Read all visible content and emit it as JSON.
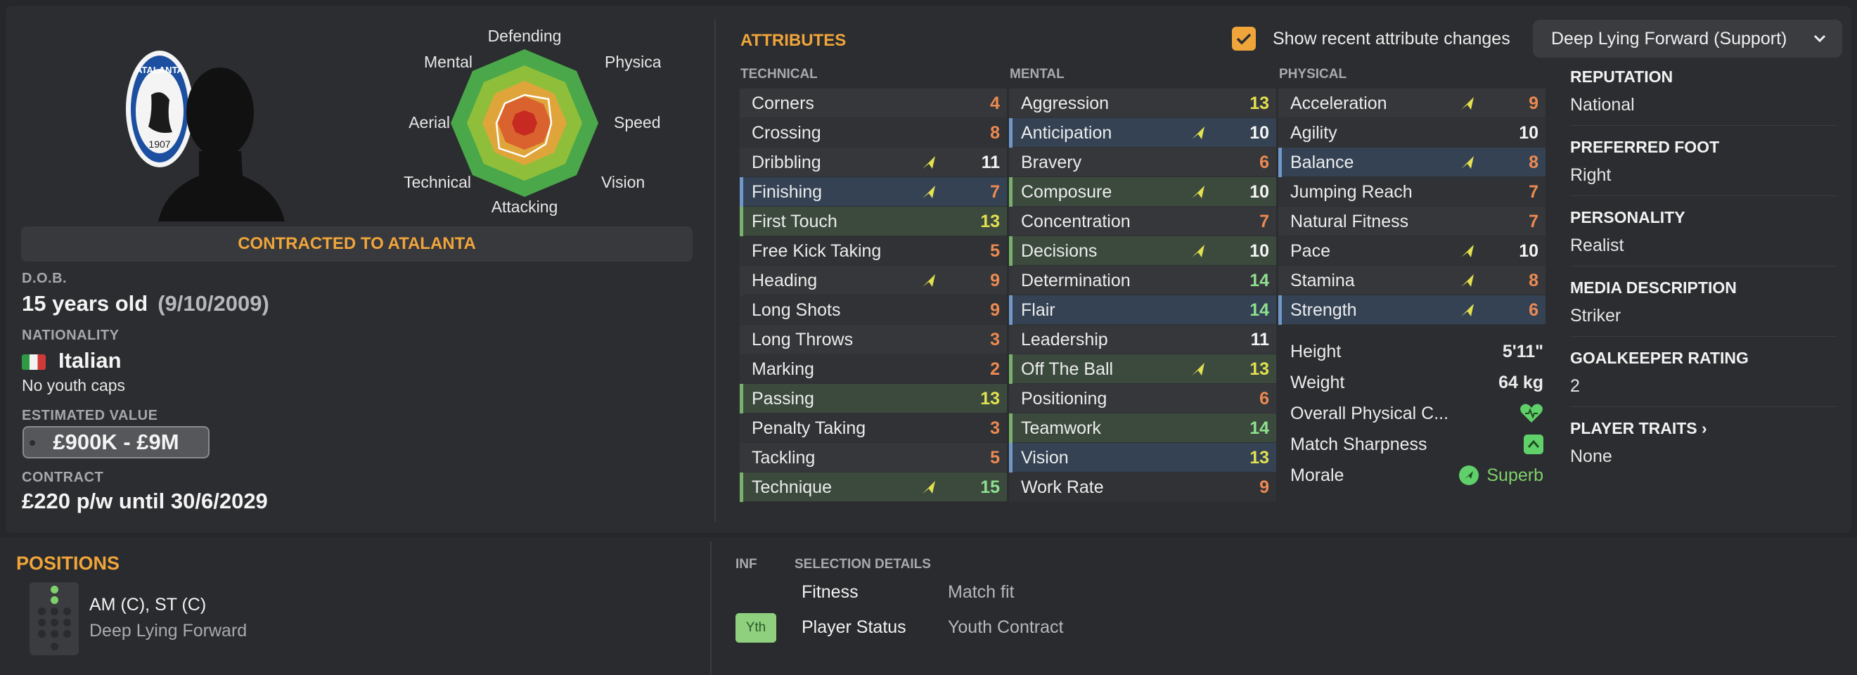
{
  "profile": {
    "club_badge_text": "ATALANTA",
    "club_badge_year": "1907",
    "contracted_banner": "CONTRACTED TO ATALANTA",
    "dob_label": "D.O.B.",
    "age": "15 years old",
    "dob": "(9/10/2009)",
    "nationality_label": "NATIONALITY",
    "nationality": "Italian",
    "youth_caps": "No youth caps",
    "value_label": "ESTIMATED VALUE",
    "value": "£900K - £9M",
    "contract_label": "CONTRACT",
    "contract": "£220 p/w until 30/6/2029"
  },
  "radar": {
    "labels": [
      "Defending",
      "Physical",
      "Speed",
      "Vision",
      "Attacking",
      "Technical",
      "Aerial",
      "Mental"
    ]
  },
  "attributes": {
    "title": "ATTRIBUTES",
    "technical_header": "TECHNICAL",
    "mental_header": "MENTAL",
    "physical_header": "PHYSICAL",
    "technical": [
      {
        "name": "Corners",
        "value": "4",
        "color": "#ec8a52",
        "arrow": false,
        "hl": ""
      },
      {
        "name": "Crossing",
        "value": "8",
        "color": "#ec8a52",
        "arrow": false,
        "hl": ""
      },
      {
        "name": "Dribbling",
        "value": "11",
        "color": "#f4f4f4",
        "arrow": true,
        "hl": ""
      },
      {
        "name": "Finishing",
        "value": "7",
        "color": "#ec8a52",
        "arrow": true,
        "hl": "blue"
      },
      {
        "name": "First Touch",
        "value": "13",
        "color": "#e3e14f",
        "arrow": false,
        "hl": "green"
      },
      {
        "name": "Free Kick Taking",
        "value": "5",
        "color": "#ec8a52",
        "arrow": false,
        "hl": ""
      },
      {
        "name": "Heading",
        "value": "9",
        "color": "#ec8a52",
        "arrow": true,
        "hl": ""
      },
      {
        "name": "Long Shots",
        "value": "9",
        "color": "#ec8a52",
        "arrow": false,
        "hl": ""
      },
      {
        "name": "Long Throws",
        "value": "3",
        "color": "#ec8a52",
        "arrow": false,
        "hl": ""
      },
      {
        "name": "Marking",
        "value": "2",
        "color": "#ec8a52",
        "arrow": false,
        "hl": ""
      },
      {
        "name": "Passing",
        "value": "13",
        "color": "#e3e14f",
        "arrow": false,
        "hl": "green"
      },
      {
        "name": "Penalty Taking",
        "value": "3",
        "color": "#ec8a52",
        "arrow": false,
        "hl": ""
      },
      {
        "name": "Tackling",
        "value": "5",
        "color": "#ec8a52",
        "arrow": false,
        "hl": ""
      },
      {
        "name": "Technique",
        "value": "15",
        "color": "#8fe08f",
        "arrow": true,
        "hl": "green"
      }
    ],
    "mental": [
      {
        "name": "Aggression",
        "value": "13",
        "color": "#e3e14f",
        "arrow": false,
        "hl": ""
      },
      {
        "name": "Anticipation",
        "value": "10",
        "color": "#f4f4f4",
        "arrow": true,
        "hl": "blue"
      },
      {
        "name": "Bravery",
        "value": "6",
        "color": "#ec8a52",
        "arrow": false,
        "hl": ""
      },
      {
        "name": "Composure",
        "value": "10",
        "color": "#f4f4f4",
        "arrow": true,
        "hl": "green"
      },
      {
        "name": "Concentration",
        "value": "7",
        "color": "#ec8a52",
        "arrow": false,
        "hl": ""
      },
      {
        "name": "Decisions",
        "value": "10",
        "color": "#f4f4f4",
        "arrow": true,
        "hl": "green"
      },
      {
        "name": "Determination",
        "value": "14",
        "color": "#8fe08f",
        "arrow": false,
        "hl": ""
      },
      {
        "name": "Flair",
        "value": "14",
        "color": "#8fe08f",
        "arrow": false,
        "hl": "blue"
      },
      {
        "name": "Leadership",
        "value": "11",
        "color": "#f4f4f4",
        "arrow": false,
        "hl": ""
      },
      {
        "name": "Off The Ball",
        "value": "13",
        "color": "#e3e14f",
        "arrow": true,
        "hl": "green"
      },
      {
        "name": "Positioning",
        "value": "6",
        "color": "#ec8a52",
        "arrow": false,
        "hl": ""
      },
      {
        "name": "Teamwork",
        "value": "14",
        "color": "#8fe08f",
        "arrow": false,
        "hl": "green"
      },
      {
        "name": "Vision",
        "value": "13",
        "color": "#e3e14f",
        "arrow": false,
        "hl": "blue"
      },
      {
        "name": "Work Rate",
        "value": "9",
        "color": "#ec8a52",
        "arrow": false,
        "hl": ""
      }
    ],
    "physical": [
      {
        "name": "Acceleration",
        "value": "9",
        "color": "#ec8a52",
        "arrow": true,
        "hl": ""
      },
      {
        "name": "Agility",
        "value": "10",
        "color": "#f4f4f4",
        "arrow": false,
        "hl": ""
      },
      {
        "name": "Balance",
        "value": "8",
        "color": "#ec8a52",
        "arrow": true,
        "hl": "blue"
      },
      {
        "name": "Jumping Reach",
        "value": "7",
        "color": "#ec8a52",
        "arrow": false,
        "hl": ""
      },
      {
        "name": "Natural Fitness",
        "value": "7",
        "color": "#ec8a52",
        "arrow": false,
        "hl": ""
      },
      {
        "name": "Pace",
        "value": "10",
        "color": "#f4f4f4",
        "arrow": true,
        "hl": ""
      },
      {
        "name": "Stamina",
        "value": "8",
        "color": "#ec8a52",
        "arrow": true,
        "hl": ""
      },
      {
        "name": "Strength",
        "value": "6",
        "color": "#ec8a52",
        "arrow": true,
        "hl": "blue"
      }
    ],
    "physical_extra": {
      "height_label": "Height",
      "height": "5'11\"",
      "weight_label": "Weight",
      "weight": "64 kg",
      "condition_label": "Overall Physical C...",
      "sharpness_label": "Match Sharpness",
      "morale_label": "Morale",
      "morale": "Superb"
    }
  },
  "sidebar": {
    "show_changes_label": "Show recent attribute changes",
    "role": "Deep Lying Forward (Support)",
    "reputation_label": "REPUTATION",
    "reputation": "National",
    "foot_label": "PREFERRED FOOT",
    "foot": "Right",
    "personality_label": "PERSONALITY",
    "personality": "Realist",
    "media_label": "MEDIA DESCRIPTION",
    "media": "Striker",
    "gk_label": "GOALKEEPER RATING",
    "gk": "2",
    "traits_label": "PLAYER TRAITS",
    "traits": "None"
  },
  "positions": {
    "title": "POSITIONS",
    "positions": "AM (C), ST (C)",
    "role": "Deep Lying Forward"
  },
  "selection": {
    "inf_header": "INF",
    "details_header": "SELECTION DETAILS",
    "fitness_label": "Fitness",
    "fitness": "Match fit",
    "status_label": "Player Status",
    "status": "Youth Contract",
    "yth_badge": "Yth"
  },
  "colors": {
    "accent": "#f0a53a",
    "low": "#ec8a52",
    "mid": "#e3e14f",
    "high": "#8fe08f",
    "highlight_green": "#79b06c",
    "highlight_blue": "#6f97c8"
  }
}
